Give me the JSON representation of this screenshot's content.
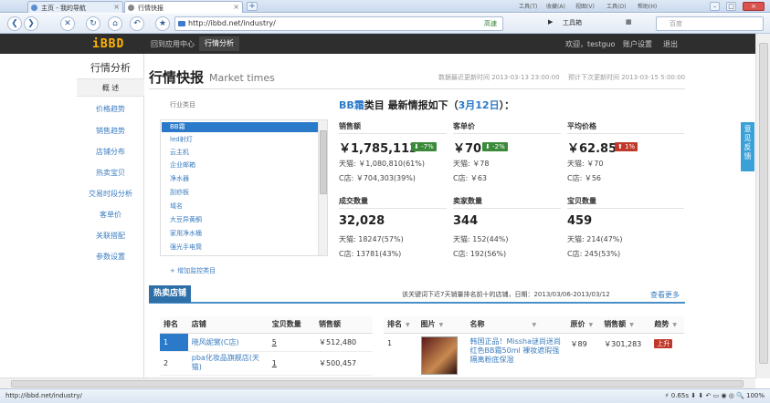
{
  "browser": {
    "tabs": [
      {
        "label": "主页 - 我的导航"
      },
      {
        "label": "行情快报"
      }
    ],
    "top_menu": [
      "工具(T)",
      "收藏(A)",
      "视图(V)",
      "工具(O)",
      "帮助(H)"
    ],
    "address": "http://ibbd.net/industry/",
    "address_right": "高速",
    "toolbox_label": "工具箱",
    "search_placeholder": "百度",
    "status_url": "http://ibbd.net/industry/",
    "status_speed": "0.65s",
    "zoom": "100%"
  },
  "site": {
    "logo": "iBBD",
    "nav": [
      "回到应用中心",
      "行情分析"
    ],
    "welcome": "欢迎，testguo",
    "account_settings": "账户设置",
    "logout": "退出"
  },
  "sidebar": {
    "title": "行情分析",
    "items": [
      "概 述",
      "价格趋势",
      "销售趋势",
      "店铺分布",
      "热卖宝贝",
      "交易时段分析",
      "客单价",
      "关联搭配",
      "参数设置"
    ]
  },
  "page": {
    "title": "行情快报",
    "subtitle": "Market times",
    "last_update": "数据最近更新时间 2013-03-13 23:00:00",
    "next_update": "预计下次更新时间 2013-03-15 5:00:00"
  },
  "categories": {
    "label": "行业类目",
    "items": [
      "BB霜",
      "led射灯",
      "云主机",
      "企业邮箱",
      "净水器",
      "刮痧板",
      "域名",
      "大豆异黄酮",
      "家用净水桶",
      "强光手电筒"
    ],
    "add_label": "+ 增加监控类目"
  },
  "summary": {
    "title_cat": "BB霜",
    "title_mid": "类目 最新情报如下（",
    "title_date": "3月12日",
    "title_end": "）：",
    "metrics": [
      {
        "label": "销售额",
        "value": "￥1,785,113",
        "badge": "⬇ -7%",
        "trend": "down",
        "tmall": "天猫: ￥1,080,810(61%)",
        "cstore": "C店: ￥704,303(39%)"
      },
      {
        "label": "客单价",
        "value": "￥70",
        "badge": "⬇ -2%",
        "trend": "down",
        "tmall": "天猫: ￥78",
        "cstore": "C店: ￥63"
      },
      {
        "label": "平均价格",
        "value": "￥62.85",
        "badge": "⬆ 1%",
        "trend": "up",
        "tmall": "天猫: ￥70",
        "cstore": "C店: ￥56"
      },
      {
        "label": "成交数量",
        "value": "32,028",
        "badge": "",
        "trend": "",
        "tmall": "天猫: 18247(57%)",
        "cstore": "C店: 13781(43%)"
      },
      {
        "label": "卖家数量",
        "value": "344",
        "badge": "",
        "trend": "",
        "tmall": "天猫: 152(44%)",
        "cstore": "C店: 192(56%)"
      },
      {
        "label": "宝贝数量",
        "value": "459",
        "badge": "",
        "trend": "",
        "tmall": "天猫: 214(47%)",
        "cstore": "C店: 245(53%)"
      }
    ]
  },
  "hot_stores": {
    "tag": "热卖店铺",
    "description": "该关键词下近7天销量排名前十的店铺，日期：2013/03/06-2013/03/12",
    "more": "查看更多",
    "store_headers": [
      "排名",
      "店铺",
      "宝贝数量",
      "销售额"
    ],
    "store_rows": [
      [
        "1",
        "晓风妮裳(C店)",
        "5",
        "￥512,480"
      ],
      [
        "2",
        "pba化妆品旗舰店(天猫)",
        "1",
        "￥500,457"
      ]
    ],
    "item_headers": [
      "排名",
      "图片",
      "名称",
      "原价",
      "销售额",
      "趋势"
    ],
    "item_rows": [
      [
        "1",
        "",
        "韩国正品！Missha谜尚迷尚红色BB霜50ml 裸妆遮瑕强 隔离粉底保湿",
        "￥89",
        "￥301,283",
        "上升"
      ]
    ]
  },
  "feedback": "意见反馈",
  "colors": {
    "accent": "#2a7ac9",
    "header": "#2e2e2e",
    "down": "#3a8a3a",
    "up": "#c0392b"
  }
}
